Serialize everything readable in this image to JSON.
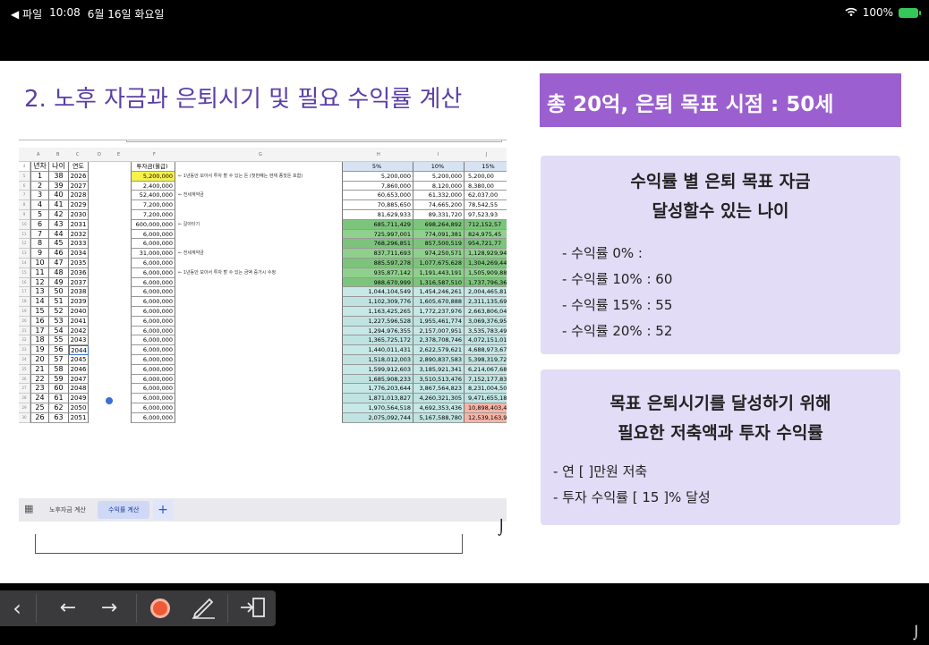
{
  "status": {
    "back_app": "◀ 파일",
    "time": "10:08",
    "date": "6월 16일 화요일",
    "wifi": "WiFi",
    "battery": "100%"
  },
  "slide": {
    "title": "2. 노후 자금과 은퇴시기 및 필요 수익률 계산",
    "goal_banner": "총 20억, 은퇴 목표 시점  : 50세",
    "box1": {
      "heading_line1": "수익률 별 은퇴 목표 자금",
      "heading_line2": "달성할수 있는 나이",
      "items": [
        "- 수익률  0% :",
        "- 수익률 10% : 60",
        "- 수익률 15% : 55",
        "- 수익률 20% : 52"
      ]
    },
    "box2": {
      "heading_line1": "목표 은퇴시기를 달성하기 위해",
      "heading_line2": "필요한 저축액과 투자 수익률",
      "items": [
        "- 연 [        ]만원 저축",
        "- 투자 수익률 [  15  ]% 달성"
      ]
    }
  },
  "spreadsheet": {
    "columns": [
      "A",
      "B",
      "C",
      "D",
      "E",
      "F",
      "G",
      "H",
      "I",
      "J"
    ],
    "headers": {
      "a": "년차",
      "b": "나이",
      "c": "연도",
      "f": "투자금(월급)",
      "h": "5%",
      "i": "10%",
      "j": "15%"
    },
    "rows": [
      {
        "rn": "5",
        "a": "1",
        "b": "38",
        "c": "2026",
        "f": "5,200,000",
        "note": "← 1년동안 모아서 투자 할 수 있는 돈 (첫번째는 현재 종잣돈 포함)",
        "h": "5,200,000",
        "i": "5,200,000",
        "j": "5,200,00"
      },
      {
        "rn": "6",
        "a": "2",
        "b": "39",
        "c": "2027",
        "f": "2,400,000",
        "note": "",
        "h": "7,860,000",
        "i": "8,120,000",
        "j": "8,380,00"
      },
      {
        "rn": "7",
        "a": "3",
        "b": "40",
        "c": "2028",
        "f": "52,400,000",
        "note": "← 전세계약금",
        "h": "60,653,000",
        "i": "61,332,000",
        "j": "62,037,00"
      },
      {
        "rn": "8",
        "a": "4",
        "b": "41",
        "c": "2029",
        "f": "7,200,000",
        "note": "",
        "h": "70,885,650",
        "i": "74,665,200",
        "j": "78,542,55"
      },
      {
        "rn": "9",
        "a": "5",
        "b": "42",
        "c": "2030",
        "f": "7,200,000",
        "note": "",
        "h": "81,629,933",
        "i": "89,331,720",
        "j": "97,523,93"
      },
      {
        "rn": "10",
        "a": "6",
        "b": "43",
        "c": "2031",
        "f": "600,000,000",
        "note": "← 갈아타기",
        "h": "685,711,429",
        "i": "698,264,892",
        "j": "712,152,57"
      },
      {
        "rn": "11",
        "a": "7",
        "b": "44",
        "c": "2032",
        "f": "6,000,000",
        "note": "",
        "h": "725,997,001",
        "i": "774,091,381",
        "j": "824,975,45"
      },
      {
        "rn": "12",
        "a": "8",
        "b": "45",
        "c": "2033",
        "f": "6,000,000",
        "note": "",
        "h": "768,296,851",
        "i": "857,500,519",
        "j": "954,721,77"
      },
      {
        "rn": "13",
        "a": "9",
        "b": "46",
        "c": "2034",
        "f": "31,000,000",
        "note": "← 전세계약금",
        "h": "837,711,693",
        "i": "974,250,571",
        "j": "1,128,929,94"
      },
      {
        "rn": "14",
        "a": "10",
        "b": "47",
        "c": "2035",
        "f": "6,000,000",
        "note": "",
        "h": "885,597,278",
        "i": "1,077,675,628",
        "j": "1,304,269,44"
      },
      {
        "rn": "15",
        "a": "11",
        "b": "48",
        "c": "2036",
        "f": "6,000,000",
        "note": "← 1년동안 모아서 투자 할 수 있는 금액 증가시 수정",
        "h": "935,877,142",
        "i": "1,191,443,191",
        "j": "1,505,909,88"
      },
      {
        "rn": "16",
        "a": "12",
        "b": "49",
        "c": "2037",
        "f": "6,000,000",
        "note": "",
        "h": "988,670,999",
        "i": "1,316,587,510",
        "j": "1,737,796,36"
      },
      {
        "rn": "17",
        "a": "13",
        "b": "50",
        "c": "2038",
        "f": "6,000,000",
        "note": "",
        "h": "1,044,104,549",
        "i": "1,454,246,261",
        "j": "2,004,465,81"
      },
      {
        "rn": "18",
        "a": "14",
        "b": "51",
        "c": "2039",
        "f": "6,000,000",
        "note": "",
        "h": "1,102,309,776",
        "i": "1,605,670,888",
        "j": "2,311,135,69"
      },
      {
        "rn": "19",
        "a": "15",
        "b": "52",
        "c": "2040",
        "f": "6,000,000",
        "note": "",
        "h": "1,163,425,265",
        "i": "1,772,237,976",
        "j": "2,663,806,04"
      },
      {
        "rn": "20",
        "a": "16",
        "b": "53",
        "c": "2041",
        "f": "6,000,000",
        "note": "",
        "h": "1,227,596,528",
        "i": "1,955,461,774",
        "j": "3,069,376,95"
      },
      {
        "rn": "21",
        "a": "17",
        "b": "54",
        "c": "2042",
        "f": "6,000,000",
        "note": "",
        "h": "1,294,976,355",
        "i": "2,157,007,951",
        "j": "3,535,783,49"
      },
      {
        "rn": "22",
        "a": "18",
        "b": "55",
        "c": "2043",
        "f": "6,000,000",
        "note": "",
        "h": "1,365,725,172",
        "i": "2,378,708,746",
        "j": "4,072,151,01"
      },
      {
        "rn": "23",
        "a": "19",
        "b": "56",
        "c": "2044",
        "f": "6,000,000",
        "note": "",
        "h": "1,440,011,431",
        "i": "2,622,579,621",
        "j": "4,688,973,67"
      },
      {
        "rn": "24",
        "a": "20",
        "b": "57",
        "c": "2045",
        "f": "6,000,000",
        "note": "",
        "h": "1,518,012,003",
        "i": "2,890,837,583",
        "j": "5,398,319,72"
      },
      {
        "rn": "25",
        "a": "21",
        "b": "58",
        "c": "2046",
        "f": "6,000,000",
        "note": "",
        "h": "1,599,912,603",
        "i": "3,185,921,341",
        "j": "6,214,067,68"
      },
      {
        "rn": "26",
        "a": "22",
        "b": "59",
        "c": "2047",
        "f": "6,000,000",
        "note": "",
        "h": "1,685,908,233",
        "i": "3,510,513,476",
        "j": "7,152,177,83"
      },
      {
        "rn": "27",
        "a": "23",
        "b": "60",
        "c": "2048",
        "f": "6,000,000",
        "note": "",
        "h": "1,776,203,644",
        "i": "3,867,564,823",
        "j": "8,231,004,50"
      },
      {
        "rn": "28",
        "a": "24",
        "b": "61",
        "c": "2049",
        "f": "6,000,000",
        "note": "",
        "h": "1,871,013,827",
        "i": "4,260,321,305",
        "j": "9,471,655,18"
      },
      {
        "rn": "29",
        "a": "25",
        "b": "62",
        "c": "2050",
        "f": "6,000,000",
        "note": "",
        "h": "1,970,564,518",
        "i": "4,692,353,436",
        "j": "10,898,403,46"
      },
      {
        "rn": "30",
        "a": "26",
        "b": "63",
        "c": "2051",
        "f": "6,000,000",
        "note": "",
        "h": "2,075,092,744",
        "i": "5,167,588,780",
        "j": "12,539,163,98"
      }
    ],
    "tabs": [
      "노후자금 계산",
      "수익률 계산"
    ],
    "add_tab": "+"
  },
  "toolbar": {
    "back": "‹",
    "prev": "←",
    "next": "→",
    "record": "record-icon",
    "pen": "pen-icon",
    "exit": "exit-icon"
  }
}
